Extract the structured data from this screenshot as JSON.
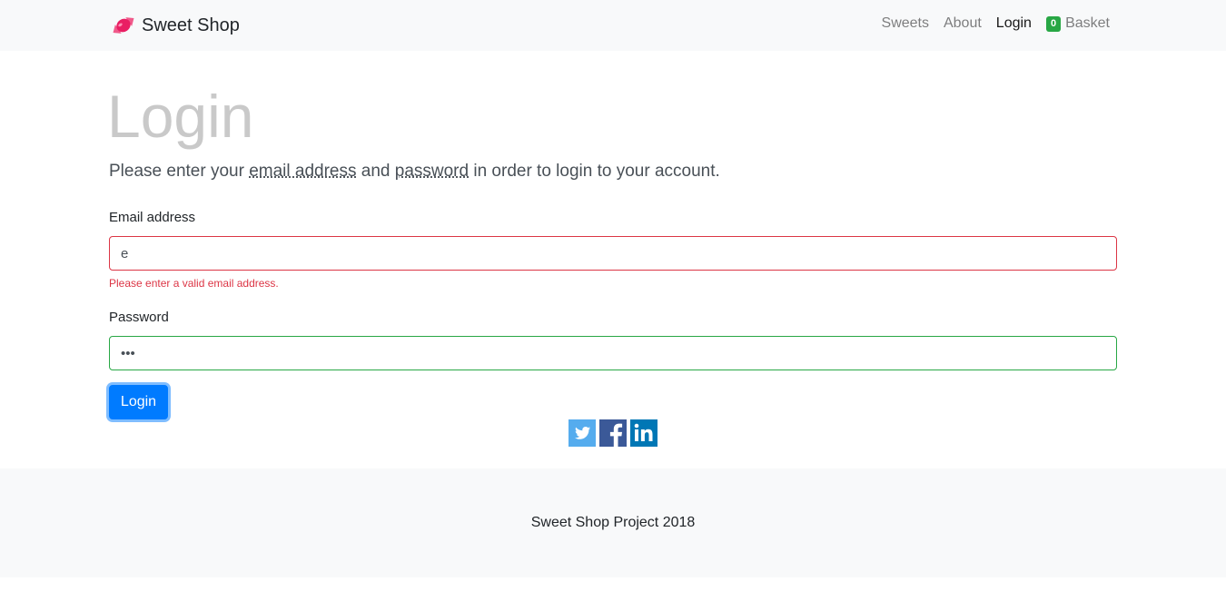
{
  "navbar": {
    "brand": "Sweet Shop",
    "brand_icon": "candy-icon",
    "links": {
      "sweets": "Sweets",
      "about": "About",
      "login": "Login",
      "basket": "Basket"
    },
    "basket_count": "0"
  },
  "main": {
    "title": "Login",
    "lead_before": "Please enter your ",
    "lead_email": "email address",
    "lead_and": " and ",
    "lead_password": "password",
    "lead_after": " in order to login to your account."
  },
  "form": {
    "email_label": "Email address",
    "email_value": "e",
    "email_error": "Please enter a valid email address.",
    "password_label": "Password",
    "password_value": "•••",
    "submit_label": "Login"
  },
  "social": {
    "icons": [
      "twitter-icon",
      "facebook-icon",
      "linkedin-icon"
    ]
  },
  "footer": {
    "text": "Sweet Shop Project 2018"
  },
  "colors": {
    "primary": "#007bff",
    "danger": "#dc3545",
    "success": "#28a745",
    "light": "#f8f9fa",
    "twitter": "#55acee",
    "facebook": "#3b5998",
    "linkedin": "#0077b5"
  }
}
